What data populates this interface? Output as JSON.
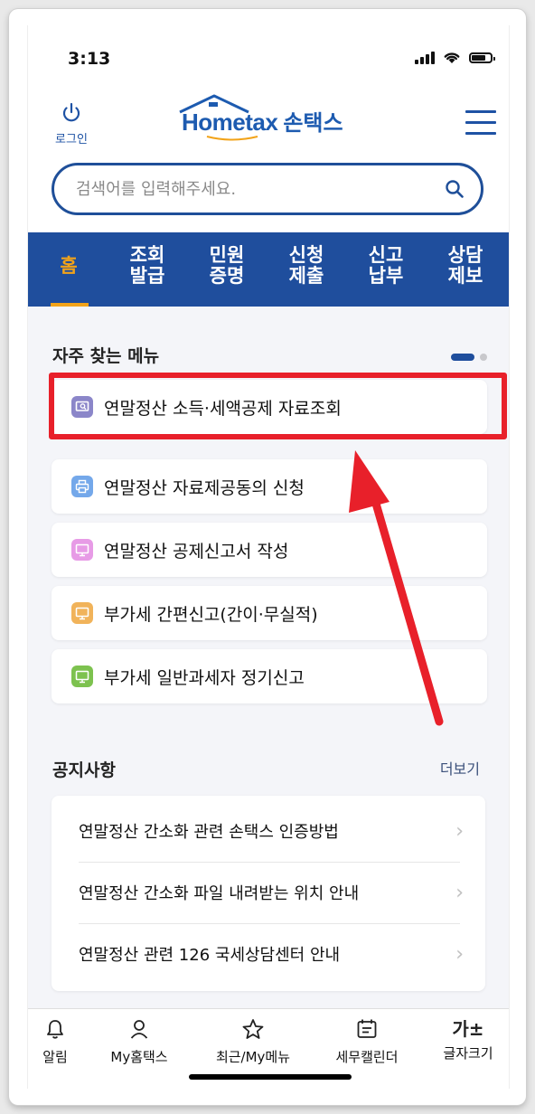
{
  "status_bar": {
    "time": "3:13"
  },
  "header": {
    "login_label": "로그인",
    "logo_word": "Hometax",
    "logo_korean": "손택스"
  },
  "search": {
    "placeholder": "검색어를 입력해주세요."
  },
  "nav": {
    "tabs": [
      {
        "line1": "홈",
        "line2": ""
      },
      {
        "line1": "조회",
        "line2": "발급"
      },
      {
        "line1": "민원",
        "line2": "증명"
      },
      {
        "line1": "신청",
        "line2": "제출"
      },
      {
        "line1": "신고",
        "line2": "납부"
      },
      {
        "line1": "상담",
        "line2": "제보"
      }
    ],
    "active_color": "#f2a319",
    "bar_color": "#1f4e9d"
  },
  "frequent_menu": {
    "title": "자주 찾는 메뉴",
    "items": [
      {
        "label": "연말정산 소득·세액공제 자료조회",
        "icon": "search-document-icon",
        "icon_color": "#8b86c9"
      },
      {
        "label": "연말정산 자료제공동의 신청",
        "icon": "printer-icon",
        "icon_color": "#74a8ea"
      },
      {
        "label": "연말정산 공제신고서 작성",
        "icon": "monitor-icon",
        "icon_color": "#e79be6"
      },
      {
        "label": "부가세 간편신고(간이·무실적)",
        "icon": "monitor-icon",
        "icon_color": "#f1b35a"
      },
      {
        "label": "부가세 일반과세자 정기신고",
        "icon": "monitor-icon",
        "icon_color": "#7dc24f"
      }
    ],
    "highlight_color": "#e8202a"
  },
  "notices": {
    "title": "공지사항",
    "more_label": "더보기",
    "items": [
      "연말정산 간소화 관련 손택스 인증방법",
      "연말정산 간소화 파일 내려받는 위치 안내",
      "연말정산 관련 126 국세상담센터 안내"
    ]
  },
  "tabbar": {
    "items": [
      {
        "label": "알림",
        "icon": "bell-icon"
      },
      {
        "label": "My홈택스",
        "icon": "person-icon"
      },
      {
        "label": "최근/My메뉴",
        "icon": "star-icon"
      },
      {
        "label": "세무캘린더",
        "icon": "calendar-icon"
      },
      {
        "label": "글자크기",
        "icon": "font-size-icon",
        "glyph": "가±"
      }
    ]
  }
}
